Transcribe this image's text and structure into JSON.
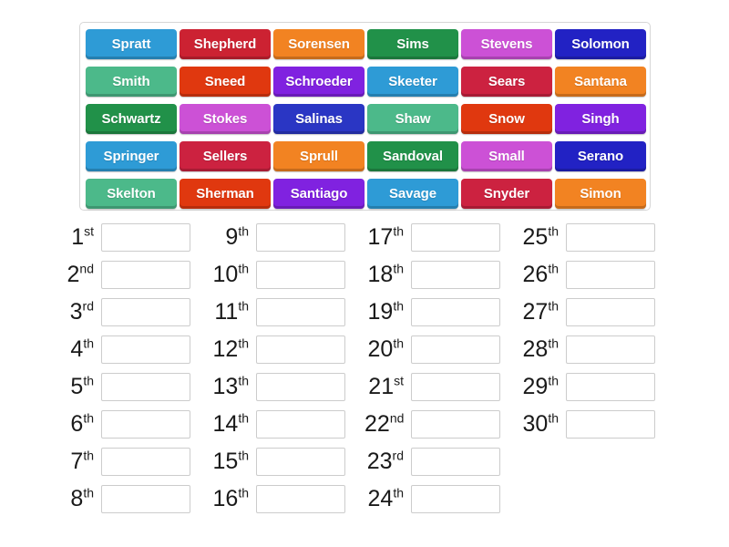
{
  "activity": {
    "type": "rank-order",
    "tile_bank": {
      "columns": 6,
      "rows": 5,
      "tiles": [
        {
          "label": "Spratt",
          "color": "#2e9bd6"
        },
        {
          "label": "Shepherd",
          "color": "#cc2232"
        },
        {
          "label": "Sorensen",
          "color": "#f28322"
        },
        {
          "label": "Sims",
          "color": "#219149"
        },
        {
          "label": "Stevens",
          "color": "#cc51d6"
        },
        {
          "label": "Solomon",
          "color": "#2222c4"
        },
        {
          "label": "Smith",
          "color": "#4cb98a"
        },
        {
          "label": "Sneed",
          "color": "#e0380f"
        },
        {
          "label": "Schroeder",
          "color": "#8022e0"
        },
        {
          "label": "Skeeter",
          "color": "#2e9bd6"
        },
        {
          "label": "Sears",
          "color": "#cc2240"
        },
        {
          "label": "Santana",
          "color": "#f28322"
        },
        {
          "label": "Schwartz",
          "color": "#219149"
        },
        {
          "label": "Stokes",
          "color": "#cc51d6"
        },
        {
          "label": "Salinas",
          "color": "#2a36c4"
        },
        {
          "label": "Shaw",
          "color": "#4cb98a"
        },
        {
          "label": "Snow",
          "color": "#e0380f"
        },
        {
          "label": "Singh",
          "color": "#8022e0"
        },
        {
          "label": "Springer",
          "color": "#2e9bd6"
        },
        {
          "label": "Sellers",
          "color": "#cc2240"
        },
        {
          "label": "Sprull",
          "color": "#f28322"
        },
        {
          "label": "Sandoval",
          "color": "#219149"
        },
        {
          "label": "Small",
          "color": "#cc51d6"
        },
        {
          "label": "Serano",
          "color": "#2222c4"
        },
        {
          "label": "Skelton",
          "color": "#4cb98a"
        },
        {
          "label": "Sherman",
          "color": "#e0380f"
        },
        {
          "label": "Santiago",
          "color": "#8022e0"
        },
        {
          "label": "Savage",
          "color": "#2e9bd6"
        },
        {
          "label": "Snyder",
          "color": "#cc2240"
        },
        {
          "label": "Simon",
          "color": "#f28322"
        }
      ]
    },
    "answer_columns": [
      {
        "rows": [
          {
            "number": "1",
            "suffix": "st",
            "value": ""
          },
          {
            "number": "2",
            "suffix": "nd",
            "value": ""
          },
          {
            "number": "3",
            "suffix": "rd",
            "value": ""
          },
          {
            "number": "4",
            "suffix": "th",
            "value": ""
          },
          {
            "number": "5",
            "suffix": "th",
            "value": ""
          },
          {
            "number": "6",
            "suffix": "th",
            "value": ""
          },
          {
            "number": "7",
            "suffix": "th",
            "value": ""
          },
          {
            "number": "8",
            "suffix": "th",
            "value": ""
          }
        ]
      },
      {
        "rows": [
          {
            "number": "9",
            "suffix": "th",
            "value": ""
          },
          {
            "number": "10",
            "suffix": "th",
            "value": ""
          },
          {
            "number": "11",
            "suffix": "th",
            "value": ""
          },
          {
            "number": "12",
            "suffix": "th",
            "value": ""
          },
          {
            "number": "13",
            "suffix": "th",
            "value": ""
          },
          {
            "number": "14",
            "suffix": "th",
            "value": ""
          },
          {
            "number": "15",
            "suffix": "th",
            "value": ""
          },
          {
            "number": "16",
            "suffix": "th",
            "value": ""
          }
        ]
      },
      {
        "rows": [
          {
            "number": "17",
            "suffix": "th",
            "value": ""
          },
          {
            "number": "18",
            "suffix": "th",
            "value": ""
          },
          {
            "number": "19",
            "suffix": "th",
            "value": ""
          },
          {
            "number": "20",
            "suffix": "th",
            "value": ""
          },
          {
            "number": "21",
            "suffix": "st",
            "value": ""
          },
          {
            "number": "22",
            "suffix": "nd",
            "value": ""
          },
          {
            "number": "23",
            "suffix": "rd",
            "value": ""
          },
          {
            "number": "24",
            "suffix": "th",
            "value": ""
          }
        ]
      },
      {
        "rows": [
          {
            "number": "25",
            "suffix": "th",
            "value": ""
          },
          {
            "number": "26",
            "suffix": "th",
            "value": ""
          },
          {
            "number": "27",
            "suffix": "th",
            "value": ""
          },
          {
            "number": "28",
            "suffix": "th",
            "value": ""
          },
          {
            "number": "29",
            "suffix": "th",
            "value": ""
          },
          {
            "number": "30",
            "suffix": "th",
            "value": ""
          }
        ]
      }
    ]
  }
}
